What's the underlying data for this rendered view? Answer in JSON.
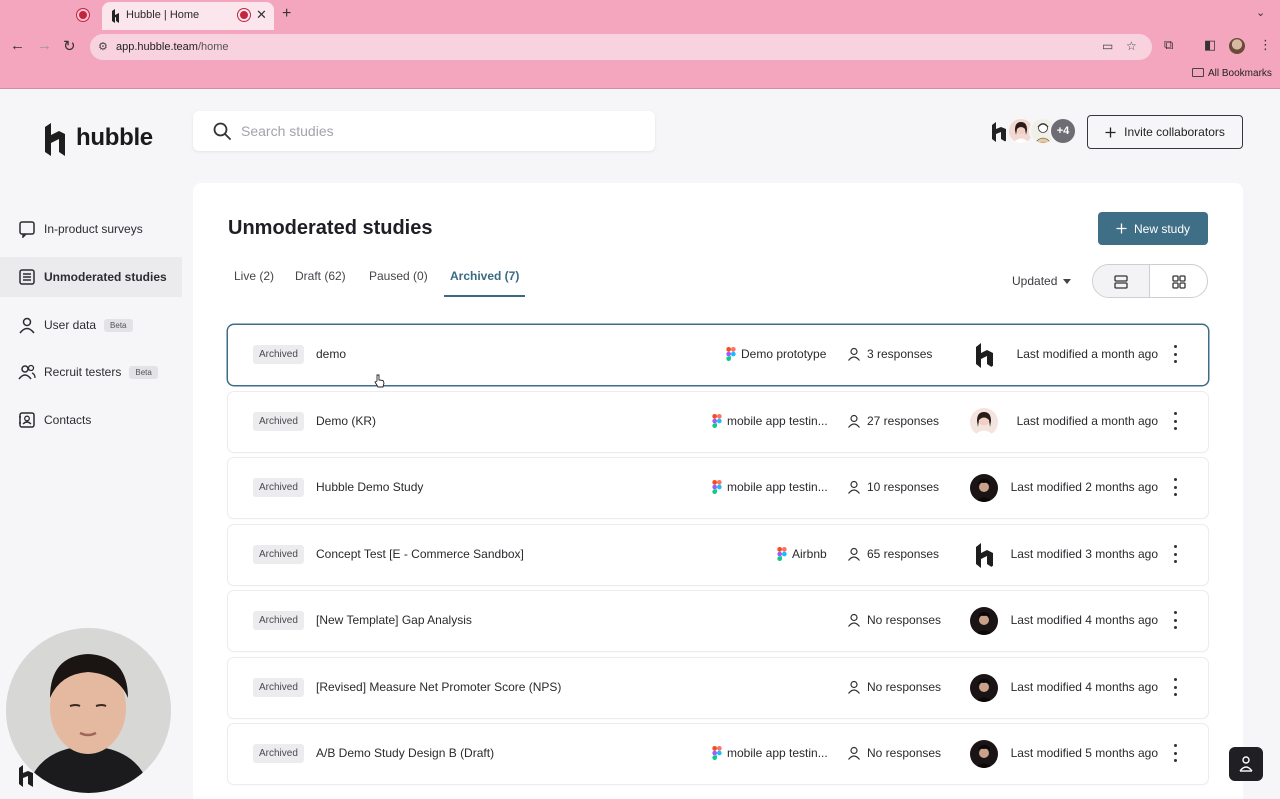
{
  "browser": {
    "tab_title": "Hubble | Home",
    "url_host": "app.hubble.team",
    "url_path": "/home",
    "bookmarks_label": "All Bookmarks"
  },
  "app": {
    "logo_text": "hubble",
    "search": {
      "placeholder": "Search studies",
      "value": ""
    },
    "collaborators_more": "+4",
    "invite_label": "Invite collaborators"
  },
  "sidebar": {
    "items": [
      {
        "label": "In-product surveys",
        "icon": "survey-icon"
      },
      {
        "label": "Unmoderated studies",
        "icon": "studies-icon",
        "active": true
      },
      {
        "label": "User data",
        "icon": "user-icon",
        "badge": "Beta"
      },
      {
        "label": "Recruit testers",
        "icon": "recruit-icon",
        "badge": "Beta"
      },
      {
        "label": "Contacts",
        "icon": "contacts-icon"
      }
    ]
  },
  "main": {
    "title": "Unmoderated studies",
    "new_study_label": "New study",
    "tabs": [
      {
        "label": "Live (2)"
      },
      {
        "label": "Draft (62)"
      },
      {
        "label": "Paused (0)"
      },
      {
        "label": "Archived (7)",
        "active": true
      }
    ],
    "sort_label": "Updated",
    "studies": [
      {
        "status": "Archived",
        "title": "demo",
        "prototype": "Demo prototype",
        "responses": "3 responses",
        "avatar": "hubble-logo",
        "modified": "Last modified a month ago"
      },
      {
        "status": "Archived",
        "title": "Demo (KR)",
        "prototype": "mobile app testin...",
        "responses": "27 responses",
        "avatar": "woman-photo",
        "modified": "Last modified a month ago"
      },
      {
        "status": "Archived",
        "title": "Hubble Demo Study",
        "prototype": "mobile app testin...",
        "responses": "10 responses",
        "avatar": "man-photo",
        "modified": "Last modified 2 months ago"
      },
      {
        "status": "Archived",
        "title": "Concept Test [E - Commerce Sandbox]",
        "prototype": "Airbnb",
        "responses": "65 responses",
        "avatar": "hubble-logo",
        "modified": "Last modified 3 months ago"
      },
      {
        "status": "Archived",
        "title": "[New Template] Gap Analysis",
        "prototype": "",
        "responses": "No responses",
        "avatar": "man-photo",
        "modified": "Last modified 4 months ago"
      },
      {
        "status": "Archived",
        "title": "[Revised] Measure Net Promoter Score (NPS)",
        "prototype": "",
        "responses": "No responses",
        "avatar": "man-photo",
        "modified": "Last modified 4 months ago"
      },
      {
        "status": "Archived",
        "title": "A/B Demo Study Design B (Draft)",
        "prototype": "mobile app testin...",
        "responses": "No responses",
        "avatar": "man-photo",
        "modified": "Last modified 5 months ago"
      }
    ]
  },
  "colors": {
    "chrome_bg": "#f4a6bf",
    "accent": "#3f6e87",
    "selected_border": "#3d6d87"
  }
}
